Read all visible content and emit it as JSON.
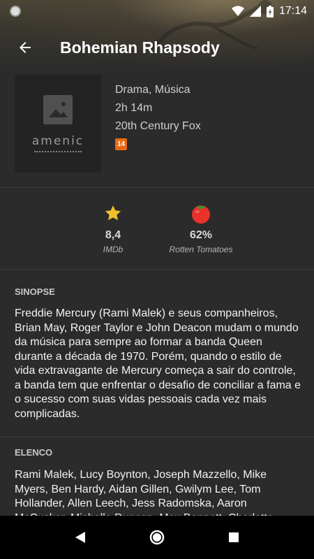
{
  "status_bar": {
    "time": "17:14"
  },
  "app_bar": {
    "title": "Bohemian Rhapsody"
  },
  "poster": {
    "brand": "amenic"
  },
  "movie": {
    "genres": "Drama, Música",
    "duration": "2h 14m",
    "studio": "20th Century Fox",
    "age_rating": "14",
    "age_rating_color": "#e86a10"
  },
  "scores": [
    {
      "icon": "star-icon",
      "value": "8,4",
      "label": "IMDb"
    },
    {
      "icon": "tomato-icon",
      "value": "62%",
      "label": "Rotten Tomatoes"
    }
  ],
  "synopsis": {
    "title": "SINOPSE",
    "text": "Freddie Mercury (Rami Malek) e seus companheiros, Brian May, Roger Taylor e John Deacon mudam o mundo da música para sempre ao formar a banda Queen durante a década de 1970. Porém, quando o estilo de vida extravagante de Mercury começa a sair do controle, a banda tem que enfrentar o desafio de conciliar a fama e o sucesso com suas vidas pessoais cada vez mais complicadas."
  },
  "cast": {
    "title": "ELENCO",
    "text": "Rami Malek, Lucy Boynton, Joseph Mazzello, Mike Myers, Ben Hardy, Aidan Gillen, Gwilym Lee, Tom Hollander, Allen Leech, Jess Radomska, Aaron McCusker, Michelle Duncan, Max Bennett, Charlotte Sheland, Ace Bhatti, Jesús Bello"
  },
  "colors": {
    "background": "#2b2b2b",
    "star": "#f0c02a",
    "tomato": "#e8322a"
  }
}
